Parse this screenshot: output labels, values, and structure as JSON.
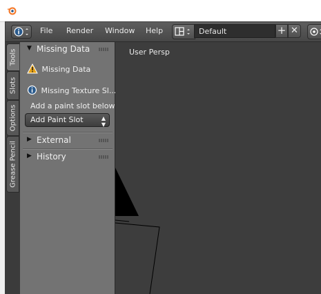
{
  "header": {
    "editor_type_icon": "info-icon",
    "menus": [
      "File",
      "Render",
      "Window",
      "Help"
    ],
    "screen_layout": "Default",
    "layout_add_symbol": "+",
    "layout_remove_symbol": "✕"
  },
  "tabs": [
    "Tools",
    "Slots",
    "Options",
    "Grease Pencil"
  ],
  "toolshelf": {
    "missing_data_panel": {
      "title": "Missing Data",
      "warning": "Missing Data",
      "info": "Missing Texture Sl...",
      "hint": "Add a paint slot below",
      "add_paint_slot": "Add Paint Slot"
    },
    "external_panel": {
      "title": "External"
    },
    "history_panel": {
      "title": "History"
    }
  },
  "viewport": {
    "label": "User Persp"
  },
  "colors": {
    "viewport_bg": "#3d3d3d",
    "toolshelf_bg": "#737373",
    "warning_icon": "#e8a317"
  }
}
